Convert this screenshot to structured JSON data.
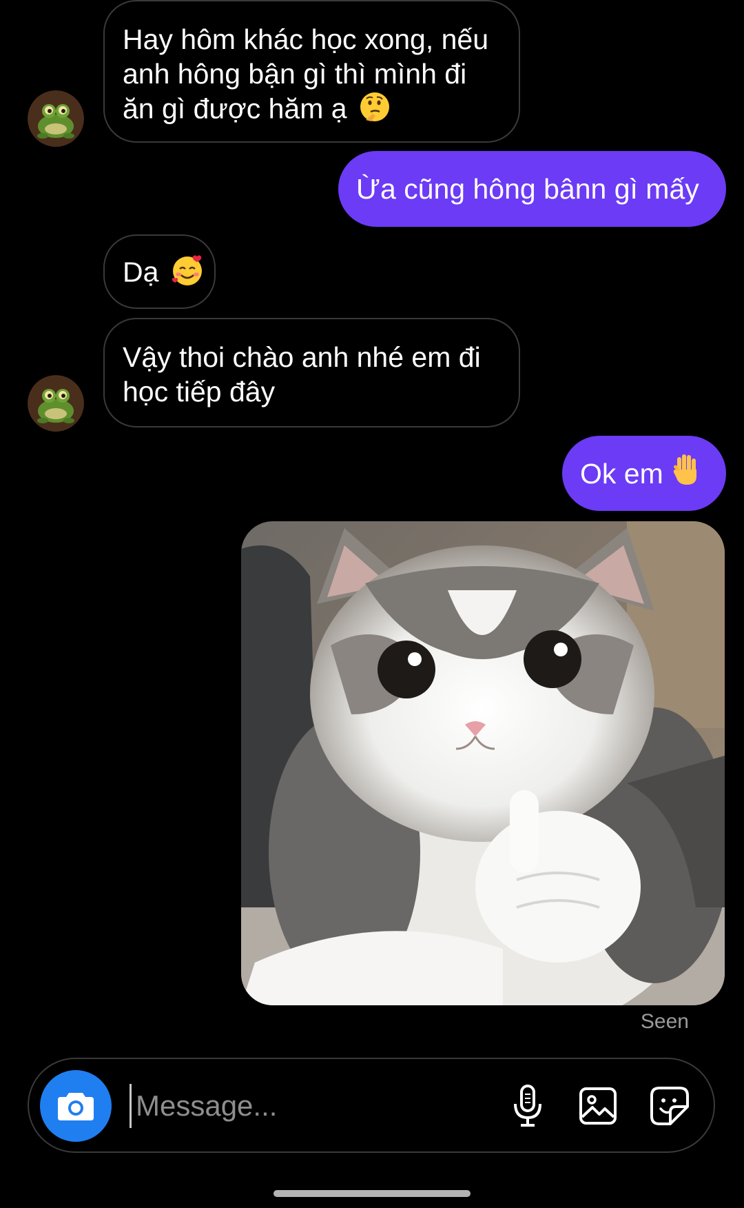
{
  "conversation": {
    "messages": [
      {
        "lines": [
          "Hay hôm khác học xong, nếu",
          "anh hông bận gì thì mình đi",
          "ăn gì được hăm ạ"
        ],
        "emoji": "thinking-face"
      },
      {
        "text": "Ừa cũng hông bânn gì mấy"
      },
      {
        "text": "Dạ",
        "emoji": "smiling-face-with-hearts"
      },
      {
        "lines": [
          "Vậy thoi chào anh nhé em đi",
          "học tiếp đây"
        ]
      },
      {
        "text": "Ok em",
        "emoji": "raised-hand"
      }
    ],
    "photo": "kitten-thumbs-up",
    "status": "Seen"
  },
  "composer": {
    "placeholder": "Message...",
    "icons": [
      "camera-icon",
      "microphone-icon",
      "gallery-icon",
      "sticker-icon"
    ]
  },
  "colors": {
    "background": "#000000",
    "sent_bubble": "#6c3bf5",
    "received_border": "#3a3a3c",
    "camera_button": "#1f7ff0",
    "seen_text": "#9a9a9a"
  }
}
